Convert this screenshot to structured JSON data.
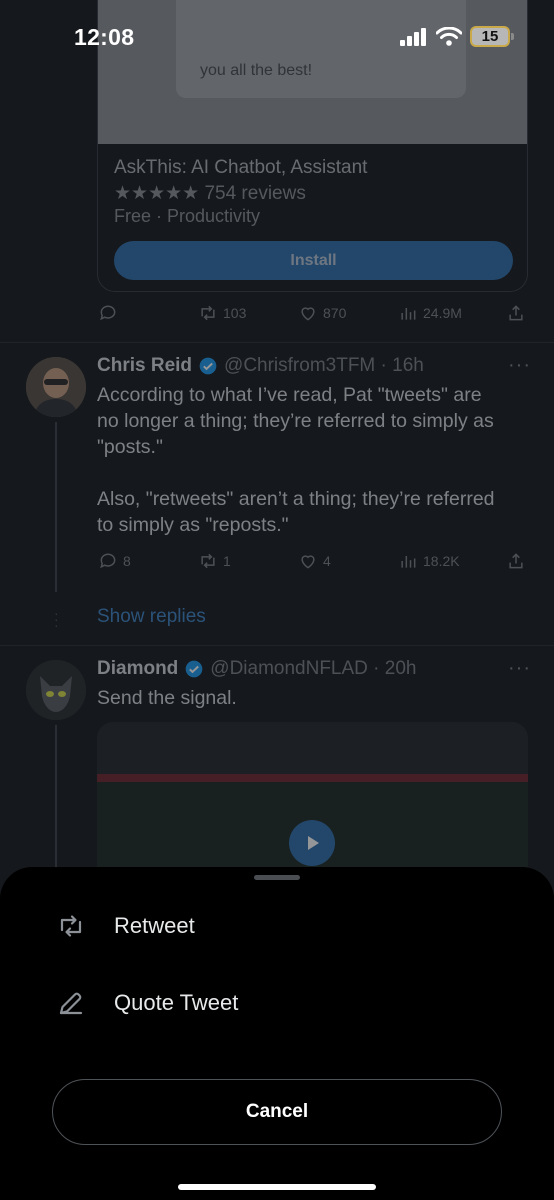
{
  "status_bar": {
    "time": "12:08",
    "battery": "15"
  },
  "ad": {
    "quote_text": "you all the best!",
    "app_title": "AskThis: AI Chatbot, Assistant",
    "rating": "★★★★★ 754 reviews",
    "category": "Free · Productivity",
    "install_label": "Install",
    "actions": {
      "retweets": "103",
      "likes": "870",
      "views": "24.9M"
    }
  },
  "tweets": [
    {
      "name": "Chris Reid",
      "handle": "@Chrisfrom3TFM · 16h",
      "text": "According to what I’ve read, Pat \"tweets\" are\nno longer a thing; they’re referred to simply as\n\"posts.\"\n\nAlso, \"retweets\" aren’t a thing; they’re referred\nto simply as \"reposts.\"",
      "actions": {
        "replies": "8",
        "retweets": "1",
        "likes": "4",
        "views": "18.2K"
      },
      "show_replies": "Show replies"
    },
    {
      "name": "Diamond",
      "handle": "@DiamondNFLAD · 20h",
      "text": "Send the signal."
    }
  ],
  "sheet": {
    "retweet_label": "Retweet",
    "quote_label": "Quote Tweet",
    "cancel_label": "Cancel"
  },
  "colors": {
    "accent": "#1d9bf0",
    "sheet_bg": "#000000",
    "feed_bg": "#15181c"
  }
}
